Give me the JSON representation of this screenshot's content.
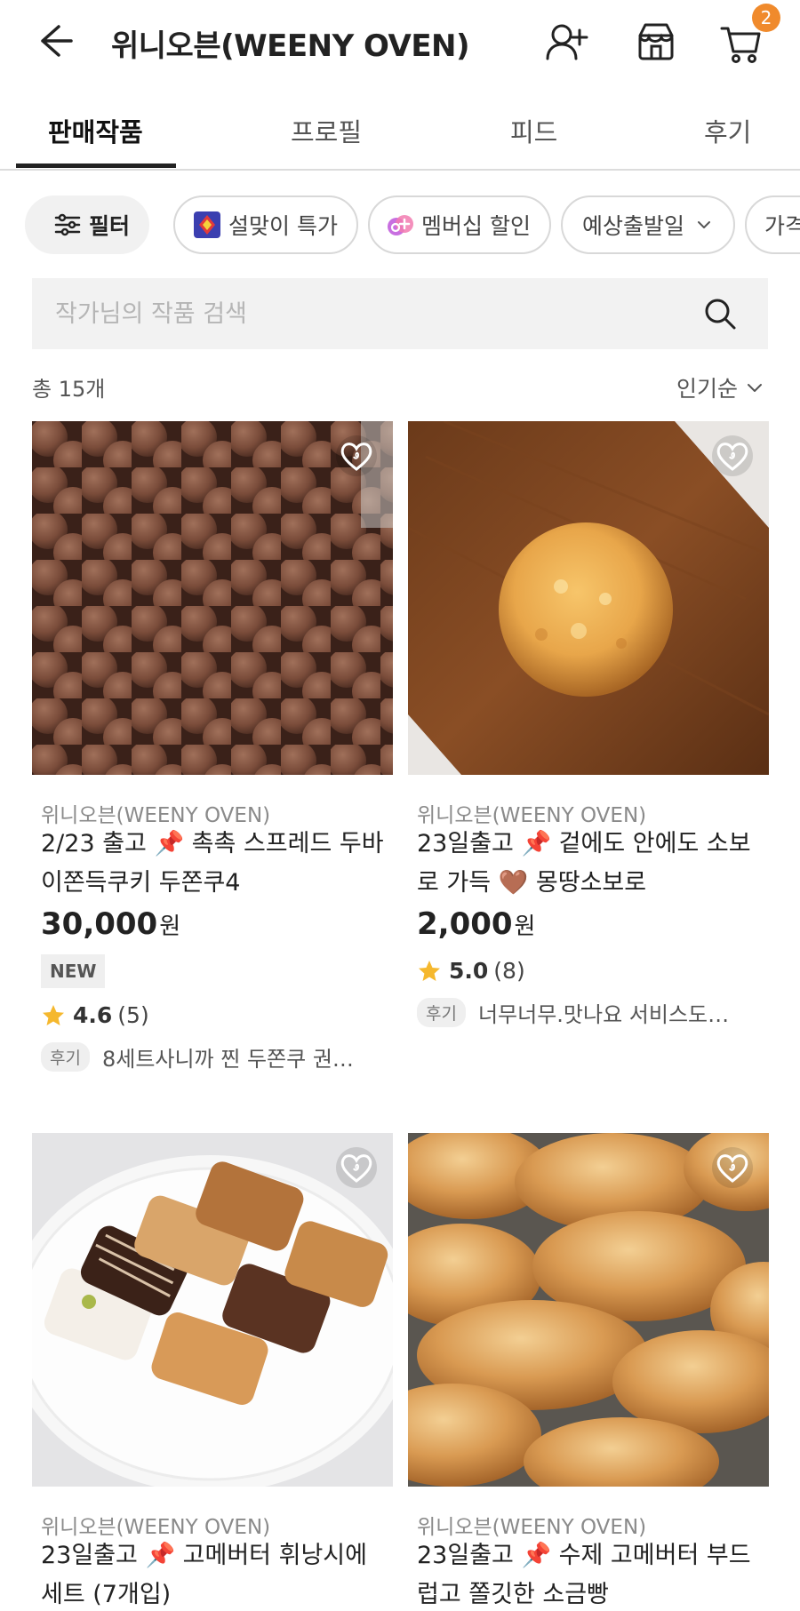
{
  "header": {
    "title": "위니오븐(WEENY OVEN)",
    "cart_count": "2"
  },
  "tabs": [
    {
      "label": "판매작품",
      "active": true
    },
    {
      "label": "프로필",
      "active": false
    },
    {
      "label": "피드",
      "active": false
    },
    {
      "label": "후기",
      "active": false
    }
  ],
  "chips": {
    "filter": "필터",
    "seasonal": "설맞이 특가",
    "membership": "멤버십 할인",
    "ship_date": "예상출발일",
    "price": "가격"
  },
  "search": {
    "placeholder": "작가님의 작품 검색"
  },
  "list": {
    "count": "총 15개",
    "sort": "인기순"
  },
  "products": [
    {
      "seller": "위니오븐(WEENY OVEN)",
      "title": "2/23 출고 📌 촉촉 스프레드 두바이쫀득쿠키 두쫀쿠4",
      "price": "30,000",
      "currency": "원",
      "badge": "NEW",
      "rating": "4.6",
      "rating_count": "(5)",
      "review_tag": "후기",
      "review": "8세트사니까 찐 두쫀쿠 권…"
    },
    {
      "seller": "위니오븐(WEENY OVEN)",
      "title": "23일출고 📌 겉에도 안에도 소보로 가득 🤎 몽땅소보로",
      "price": "2,000",
      "currency": "원",
      "rating": "5.0",
      "rating_count": "(8)",
      "review_tag": "후기",
      "review": "너무너무.맛나요 서비스도…"
    },
    {
      "seller": "위니오븐(WEENY OVEN)",
      "title": "23일출고 📌 고메버터 휘낭시에 세트 (7개입)"
    },
    {
      "seller": "위니오븐(WEENY OVEN)",
      "title": "23일출고 📌 수제 고메버터 부드럽고 쫄깃한 소금빵"
    }
  ],
  "colors": {
    "accent": "#f08a2c",
    "star": "#f5b82e",
    "text": "#222222"
  }
}
